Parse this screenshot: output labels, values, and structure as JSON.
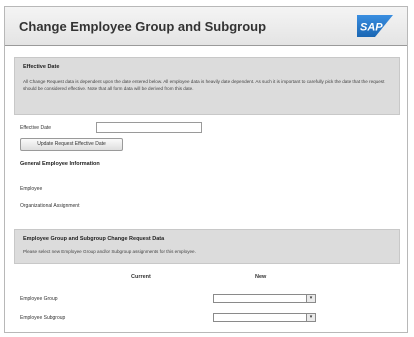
{
  "page": {
    "title": "Change Employee Group and Subgroup",
    "logo_text": "SAP"
  },
  "effective_date": {
    "section_title": "Effective Date",
    "description": "All Change Request data is dependent upon the date entered below.  All employee data is heavily date dependent.  As such it is important to carefully pick the date that the request should be considered effective.  Note that all form data will be derived from this date.",
    "date_label": "Effective Date",
    "date_value": "",
    "update_button_label": "Update Request Effective Date"
  },
  "general_info": {
    "heading": "General Employee Information",
    "employee_label": "Employee",
    "org_assignment_label": "Organizational Assignment"
  },
  "change_request": {
    "section_title": "Employee Group and Subgroup Change Request Data",
    "description": "Please select new Employee Group and/or Subgroup assignments for this employee.",
    "col_current": "Current",
    "col_new": "New",
    "rows": [
      {
        "label": "Employee Group",
        "current": "",
        "new_value": ""
      },
      {
        "label": "Employee Subgroup",
        "current": "",
        "new_value": ""
      }
    ]
  },
  "colors": {
    "section_bg": "#dcdcdc",
    "sap_blue": "#1a66b3"
  }
}
